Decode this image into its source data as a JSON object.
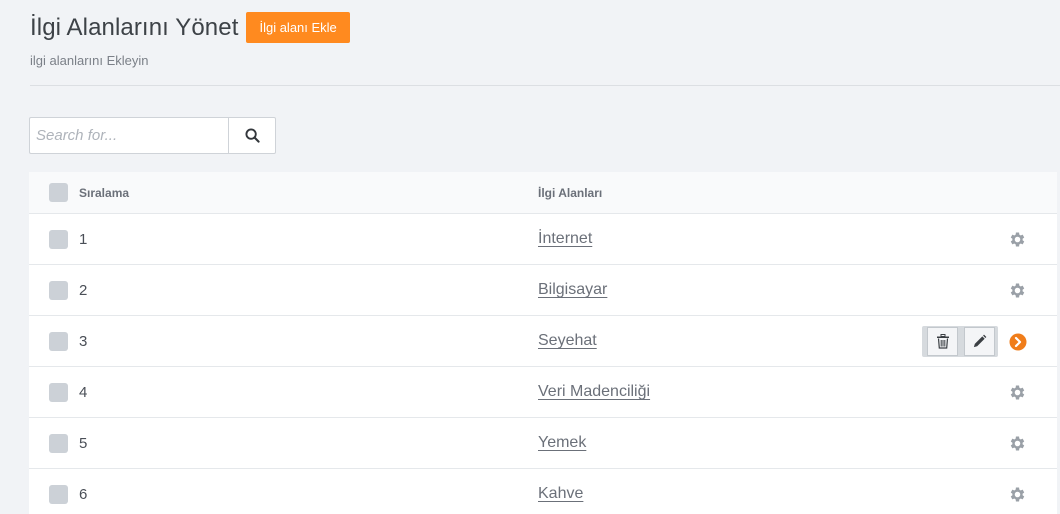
{
  "header": {
    "title": "İlgi Alanlarını Yönet",
    "add_button": "İlgi alanı Ekle",
    "subtitle": "ilgi alanlarını Ekleyin"
  },
  "search": {
    "placeholder": "Search for...",
    "value": ""
  },
  "table": {
    "columns": [
      "Sıralama",
      "İlgi Alanları"
    ],
    "rows": [
      {
        "order": "1",
        "name": "İnternet"
      },
      {
        "order": "2",
        "name": "Bilgisayar"
      },
      {
        "order": "3",
        "name": "Seyehat"
      },
      {
        "order": "4",
        "name": "Veri Madenciliği"
      },
      {
        "order": "5",
        "name": "Yemek"
      },
      {
        "order": "6",
        "name": "Kahve"
      }
    ]
  },
  "icons": {
    "search": "search-icon",
    "settings": "gear-icon",
    "delete": "trash-icon",
    "edit": "pencil-icon",
    "expand": "chevron-right-circle-icon"
  },
  "colors": {
    "accent": "#ff8a1f",
    "checkbox": "#ccd1d7",
    "icon": "#9aa0a7"
  }
}
